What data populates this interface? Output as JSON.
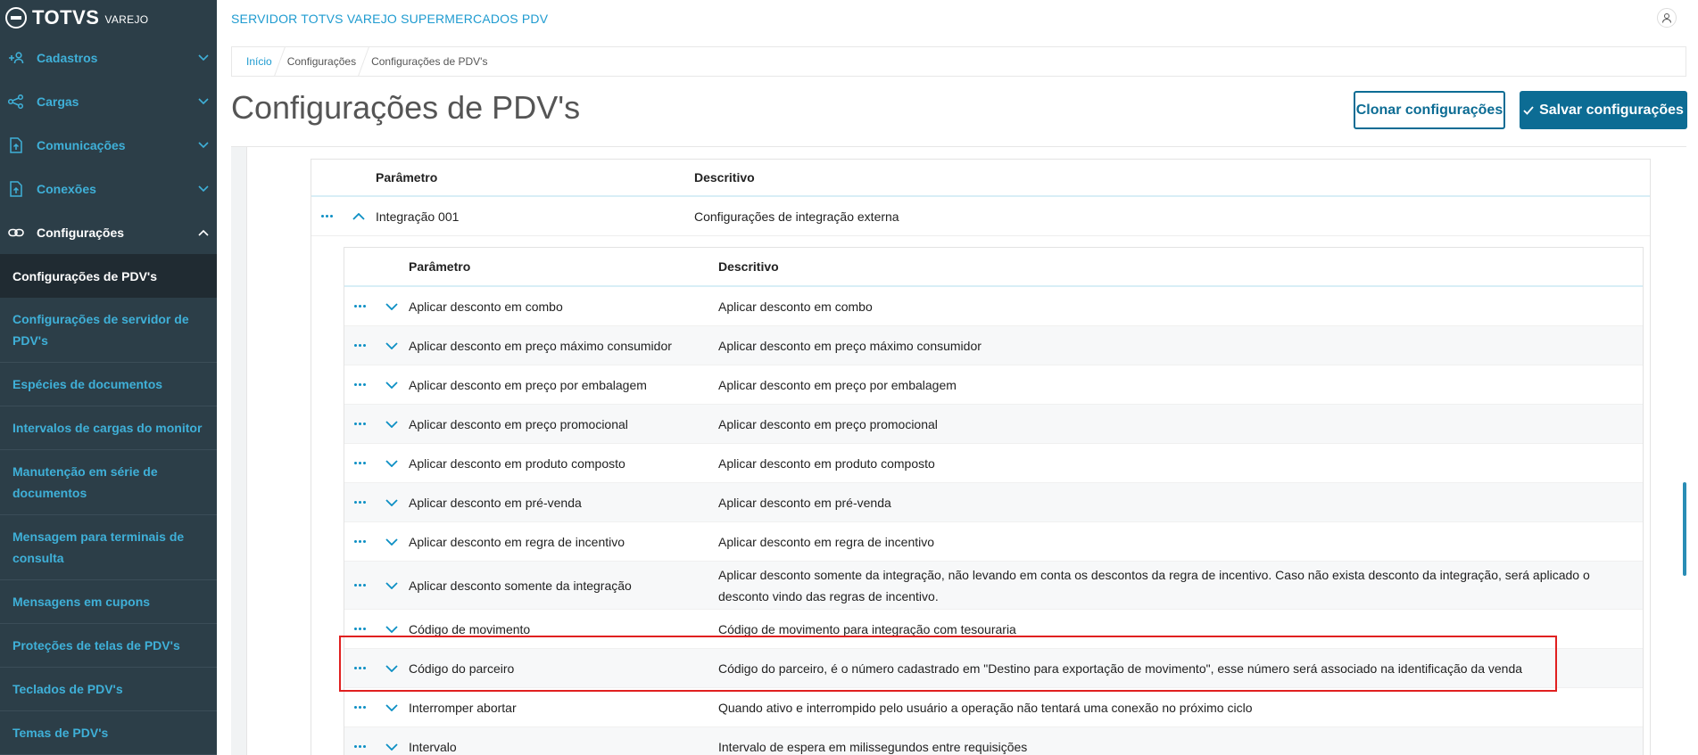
{
  "brand": {
    "name": "TOTVS",
    "sub": "VAREJO"
  },
  "header": {
    "app_title": "SERVIDOR TOTVS VAREJO SUPERMERCADOS PDV"
  },
  "sidebar": {
    "groups": [
      {
        "label": "Cadastros",
        "icon": "add-user-icon"
      },
      {
        "label": "Cargas",
        "icon": "share-icon"
      },
      {
        "label": "Comunicações",
        "icon": "upload-file-icon"
      },
      {
        "label": "Conexões",
        "icon": "upload-file-icon"
      },
      {
        "label": "Configurações",
        "icon": "link-icon",
        "expanded": true
      }
    ],
    "active_item": "Configurações de PDV's",
    "items": [
      "Configurações de servidor de PDV's",
      "Espécies de documentos",
      "Intervalos de cargas do monitor",
      "Manutenção em série de documentos",
      "Mensagem para terminais de consulta",
      "Mensagens em cupons",
      "Proteções de telas de PDV's",
      "Teclados de PDV's",
      "Temas de PDV's"
    ]
  },
  "breadcrumb": [
    "Início",
    "Configurações",
    "Configurações de PDV's"
  ],
  "page_title": "Configurações de PDV's",
  "actions": {
    "clone_label": "Clonar configurações",
    "save_label": "Salvar configurações"
  },
  "table": {
    "col_param": "Parâmetro",
    "col_desc": "Descritivo",
    "group_row": {
      "param": "Integração 001",
      "desc": "Configurações de integração externa"
    },
    "inner": {
      "col_param": "Parâmetro",
      "col_desc": "Descritivo",
      "rows": [
        {
          "param": "Aplicar desconto em combo",
          "desc": "Aplicar desconto em combo"
        },
        {
          "param": "Aplicar desconto em preço máximo consumidor",
          "desc": "Aplicar desconto em preço máximo consumidor"
        },
        {
          "param": "Aplicar desconto em preço por embalagem",
          "desc": "Aplicar desconto em preço por embalagem"
        },
        {
          "param": "Aplicar desconto em preço promocional",
          "desc": "Aplicar desconto em preço promocional"
        },
        {
          "param": "Aplicar desconto em produto composto",
          "desc": "Aplicar desconto em produto composto"
        },
        {
          "param": "Aplicar desconto em pré-venda",
          "desc": "Aplicar desconto em pré-venda"
        },
        {
          "param": "Aplicar desconto em regra de incentivo",
          "desc": "Aplicar desconto em regra de incentivo"
        },
        {
          "param": "Aplicar desconto somente da integração",
          "desc": "Aplicar desconto somente da integração, não levando em conta os descontos da regra de incentivo. Caso não exista desconto da integração, será aplicado o desconto vindo das regras de incentivo."
        },
        {
          "param": "Código de movimento",
          "desc": "Código de movimento para integração com tesouraria"
        },
        {
          "param": "Código do parceiro",
          "desc": "Código do parceiro, é o número cadastrado em \"Destino para exportação de movimento\", esse número será associado na identificação da venda"
        },
        {
          "param": "Interromper abortar",
          "desc": "Quando ativo e interrompido pelo usuário a operação não tentará uma conexão no próximo ciclo"
        },
        {
          "param": "Intervalo",
          "desc": "Intervalo de espera em milissegundos entre requisições"
        }
      ]
    }
  },
  "colors": {
    "accent": "#0c6c94",
    "link": "#1e9bd0",
    "sidebar": "#2c3e48",
    "highlight": "#e02020"
  }
}
